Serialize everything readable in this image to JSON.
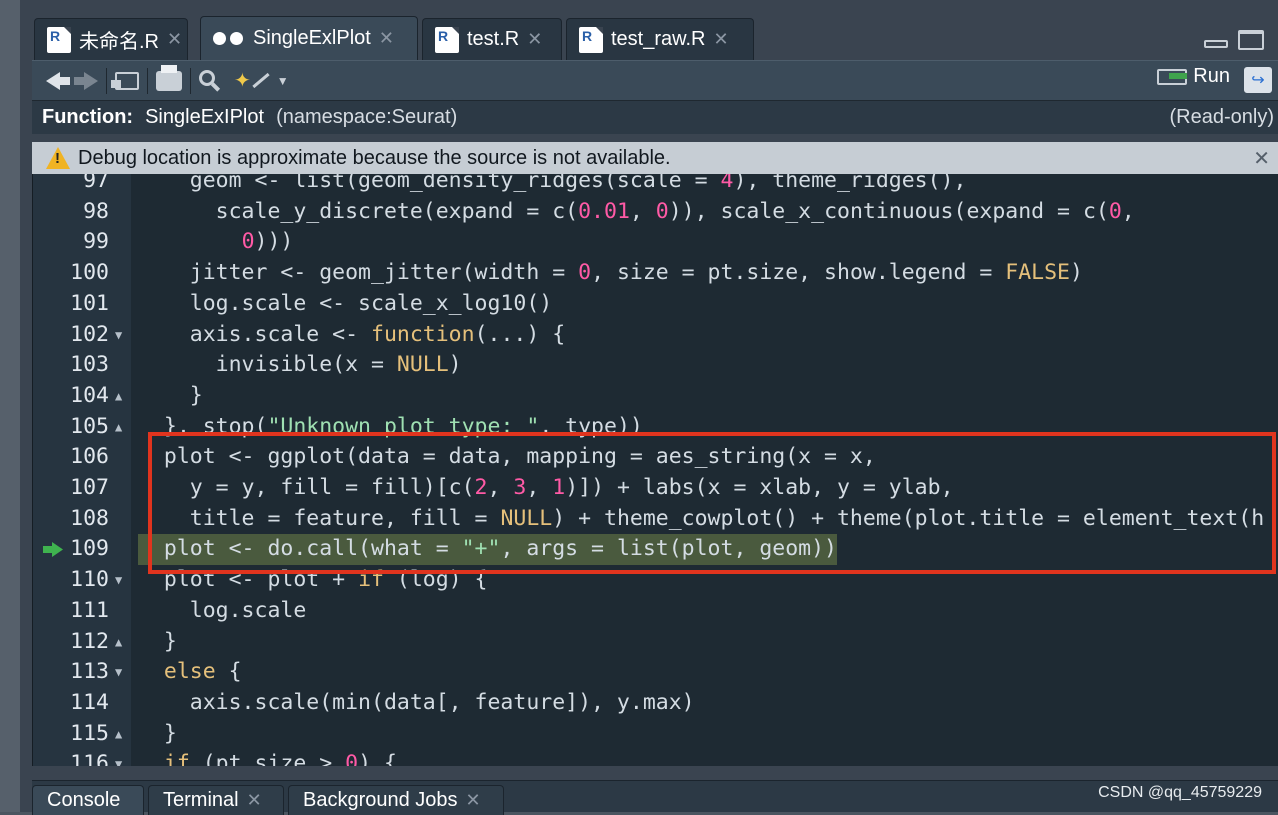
{
  "tabs": [
    {
      "label": "未命名.R",
      "icon": "r-file-icon"
    },
    {
      "label": "SingleExlPlot",
      "icon": "function-view-icon",
      "active": true
    },
    {
      "label": "test.R",
      "icon": "r-file-icon"
    },
    {
      "label": "test_raw.R",
      "icon": "r-file-icon"
    }
  ],
  "toolbar": {
    "run_label": "Run"
  },
  "function_bar": {
    "label": "Function:",
    "name": "SingleExIPlot",
    "namespace": "(namespace:Seurat)",
    "readonly": "(Read-only)"
  },
  "warning": {
    "text": "Debug location is approximate because the source is not available."
  },
  "code_lines": [
    {
      "num": "97",
      "fold": "",
      "text": "    geom <- list(geom_density_ridges(scale = 4), theme_ridges(),"
    },
    {
      "num": "98",
      "fold": "",
      "text": "      scale_y_discrete(expand = c(0.01, 0)), scale_x_continuous(expand = c(0,"
    },
    {
      "num": "99",
      "fold": "",
      "text": "        0)))"
    },
    {
      "num": "100",
      "fold": "",
      "text": "    jitter <- geom_jitter(width = 0, size = pt.size, show.legend = FALSE)"
    },
    {
      "num": "101",
      "fold": "",
      "text": "    log.scale <- scale_x_log10()"
    },
    {
      "num": "102",
      "fold": "▼",
      "text": "    axis.scale <- function(...) {"
    },
    {
      "num": "103",
      "fold": "",
      "text": "      invisible(x = NULL)"
    },
    {
      "num": "104",
      "fold": "▲",
      "text": "    }"
    },
    {
      "num": "105",
      "fold": "▲",
      "text": "  }, stop(\"Unknown plot type: \", type))"
    },
    {
      "num": "106",
      "fold": "",
      "text": "  plot <- ggplot(data = data, mapping = aes_string(x = x,"
    },
    {
      "num": "107",
      "fold": "",
      "text": "    y = y, fill = fill)[c(2, 3, 1)]) + labs(x = xlab, y = ylab,"
    },
    {
      "num": "108",
      "fold": "",
      "text": "    title = feature, fill = NULL) + theme_cowplot() + theme(plot.title = element_text(h"
    },
    {
      "num": "109",
      "fold": "",
      "text": "  plot <- do.call(what = \"+\", args = list(plot, geom))",
      "current": true
    },
    {
      "num": "110",
      "fold": "▼",
      "text": "  plot <- plot + if (log) {"
    },
    {
      "num": "111",
      "fold": "",
      "text": "    log.scale"
    },
    {
      "num": "112",
      "fold": "▲",
      "text": "  }"
    },
    {
      "num": "113",
      "fold": "▼",
      "text": "  else {"
    },
    {
      "num": "114",
      "fold": "",
      "text": "    axis.scale(min(data[, feature]), y.max)"
    },
    {
      "num": "115",
      "fold": "▲",
      "text": "  }"
    },
    {
      "num": "116",
      "fold": "▼",
      "text": "  if (pt.size > 0) {"
    }
  ],
  "bottom_tabs": [
    {
      "label": "Console"
    },
    {
      "label": "Terminal"
    },
    {
      "label": "Background Jobs"
    }
  ],
  "watermark": "CSDN @qq_45759229",
  "colors": {
    "highlight_box": "#e1341e",
    "current_line": "#4a5a3e",
    "editor_bg": "#1e2a33"
  }
}
